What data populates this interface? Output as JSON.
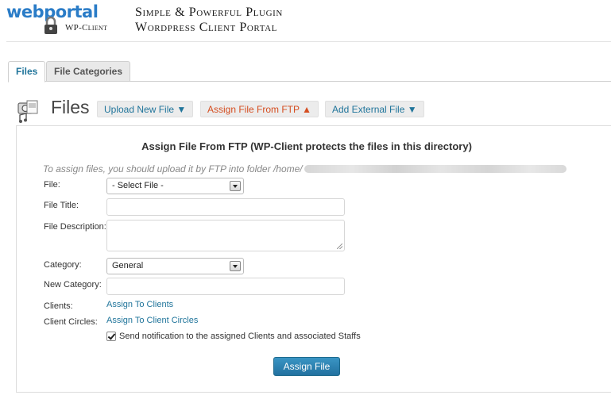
{
  "header": {
    "logo_web": "web",
    "logo_portal": "portal",
    "logo_sub": "WP-Client",
    "tagline_line1": "Simple & Powerful Plugin",
    "tagline_line2": "Wordpress Client Portal"
  },
  "tabs": [
    {
      "label": "Files",
      "active": true
    },
    {
      "label": "File Categories",
      "active": false
    }
  ],
  "page": {
    "title": "Files",
    "title_icon": "files-media-icon",
    "buttons": [
      {
        "label": "Upload New File ▼"
      },
      {
        "label": "Assign File From FTP ▲"
      },
      {
        "label": "Add External File ▼"
      }
    ]
  },
  "form": {
    "heading": "Assign File From FTP (WP-Client protects the files in this directory)",
    "hint": "To assign files, you should upload it by FTP into folder /home/",
    "fields": {
      "file_label": "File:",
      "file_value": "- Select File -",
      "title_label": "File Title:",
      "title_value": "",
      "description_label": "File Description:",
      "description_value": "",
      "category_label": "Category:",
      "category_value": "General",
      "new_category_label": "New Category:",
      "new_category_value": "",
      "clients_label": "Clients:",
      "clients_link": "Assign To Clients",
      "circles_label": "Client Circles:",
      "circles_link": "Assign To Client Circles",
      "notify_label": "Send notification to the assigned Clients and associated Staffs",
      "notify_checked": true
    },
    "submit_label": "Assign File"
  },
  "colors": {
    "accent": "#21759b",
    "active_toggle": "#d54e21",
    "primary_button": "#2a82b3"
  }
}
